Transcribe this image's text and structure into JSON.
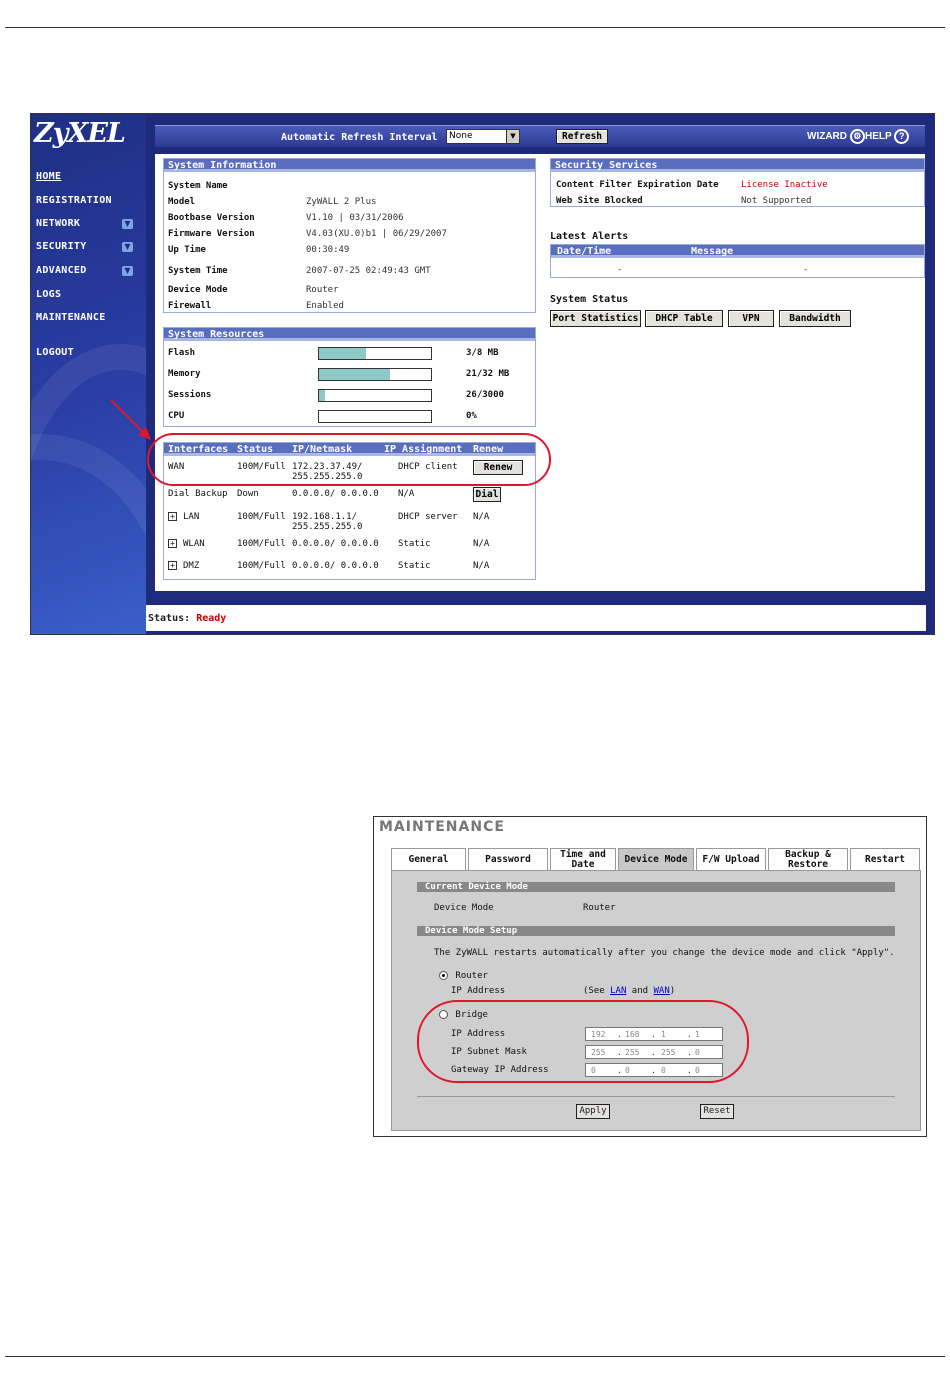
{
  "dashboard": {
    "logo": "ZyXEL",
    "nav": {
      "home": "HOME",
      "registration": "REGISTRATION",
      "network": "NETWORK",
      "security": "SECURITY",
      "advanced": "ADVANCED",
      "logs": "LOGS",
      "maintenance": "MAINTENANCE",
      "logout": "LOGOUT"
    },
    "topbar": {
      "refresh_interval_label": "Automatic Refresh Interval",
      "refresh_interval_value": "None",
      "refresh_button": "Refresh",
      "wizard": "WIZARD",
      "help": "HELP"
    },
    "system_information": {
      "title": "System Information",
      "rows": [
        {
          "label": "System Name",
          "value": ""
        },
        {
          "label": "Model",
          "value": "ZyWALL 2 Plus"
        },
        {
          "label": "Bootbase Version",
          "value": "V1.10 | 03/31/2006"
        },
        {
          "label": "Firmware Version",
          "value": "V4.03(XU.0)b1 | 06/29/2007"
        },
        {
          "label": "Up Time",
          "value": "00:30:49"
        },
        {
          "label": "System Time",
          "value": "2007-07-25 02:49:43 GMT"
        },
        {
          "label": "Device Mode",
          "value": "Router"
        },
        {
          "label": "Firewall",
          "value": "Enabled"
        }
      ]
    },
    "system_resources": {
      "title": "System Resources",
      "rows": [
        {
          "label": "Flash",
          "value": "3/8 MB",
          "level": 0.42
        },
        {
          "label": "Memory",
          "value": "21/32 MB",
          "level": 0.63
        },
        {
          "label": "Sessions",
          "value": "26/3000",
          "level": 0.05
        },
        {
          "label": "CPU",
          "value": "0%",
          "level": 0
        }
      ]
    },
    "interfaces": {
      "headers": [
        "Interfaces",
        "Status",
        "IP/Netmask",
        "IP Assignment",
        "Renew"
      ],
      "rows": [
        {
          "name": "WAN",
          "status": "100M/Full",
          "ip": "172.23.37.49/",
          "mask": "255.255.255.0",
          "assignment": "DHCP client",
          "renew": "Renew"
        },
        {
          "name": "Dial Backup",
          "status": "Down",
          "ip": "0.0.0.0/ 0.0.0.0",
          "mask": "",
          "assignment": "N/A",
          "renew": "Dial"
        },
        {
          "name": "LAN",
          "status": "100M/Full",
          "ip": "192.168.1.1/",
          "mask": "255.255.255.0",
          "assignment": "DHCP server",
          "renew": "N/A"
        },
        {
          "name": "WLAN",
          "status": "100M/Full",
          "ip": "0.0.0.0/ 0.0.0.0",
          "mask": "",
          "assignment": "Static",
          "renew": "N/A"
        },
        {
          "name": "DMZ",
          "status": "100M/Full",
          "ip": "0.0.0.0/ 0.0.0.0",
          "mask": "",
          "assignment": "Static",
          "renew": "N/A"
        }
      ]
    },
    "security_services": {
      "title": "Security Services",
      "rows": [
        {
          "label": "Content Filter Expiration Date",
          "value": "License Inactive"
        },
        {
          "label": "Web Site Blocked",
          "value": "Not Supported"
        }
      ]
    },
    "latest_alerts": {
      "title": "Latest Alerts",
      "headers": [
        "Date/Time",
        "Message"
      ],
      "row": [
        "-",
        "-"
      ]
    },
    "system_status": {
      "title": "System Status",
      "buttons": [
        "Port Statistics",
        "DHCP Table",
        "VPN",
        "Bandwidth"
      ]
    },
    "status": {
      "label": "Status:",
      "value": "Ready"
    },
    "colors": {
      "highlight": "#e0162b",
      "alert_red": "#cc0000",
      "nav_bg": "#1f2f84"
    }
  },
  "maintenance": {
    "title": "MAINTENANCE",
    "tabs": [
      "General",
      "Password",
      "Time and Date",
      "Device Mode",
      "F/W Upload",
      "Backup & Restore",
      "Restart"
    ],
    "active_tab": "Device Mode",
    "current_mode_header": "Current Device Mode",
    "device_mode_label": "Device Mode",
    "device_mode_value": "Router",
    "setup_header": "Device Mode Setup",
    "note": "The ZyWALL restarts automatically after you change the device mode and click \"Apply\".",
    "router_label": "Router",
    "router_ip_label": "IP Address",
    "router_ip_hint_prefix": "(See",
    "router_ip_hint_lan": "LAN",
    "router_ip_hint_and": "and",
    "router_ip_hint_wan": "WAN",
    "router_ip_hint_suffix": ")",
    "bridge_label": "Bridge",
    "bridge_fields": [
      {
        "label": "IP Address",
        "octets": [
          "192",
          "168",
          "1",
          "1"
        ]
      },
      {
        "label": "IP Subnet Mask",
        "octets": [
          "255",
          "255",
          "255",
          "0"
        ]
      },
      {
        "label": "Gateway IP Address",
        "octets": [
          "0",
          "0",
          "0",
          "0"
        ]
      }
    ],
    "apply": "Apply",
    "reset": "Reset"
  }
}
